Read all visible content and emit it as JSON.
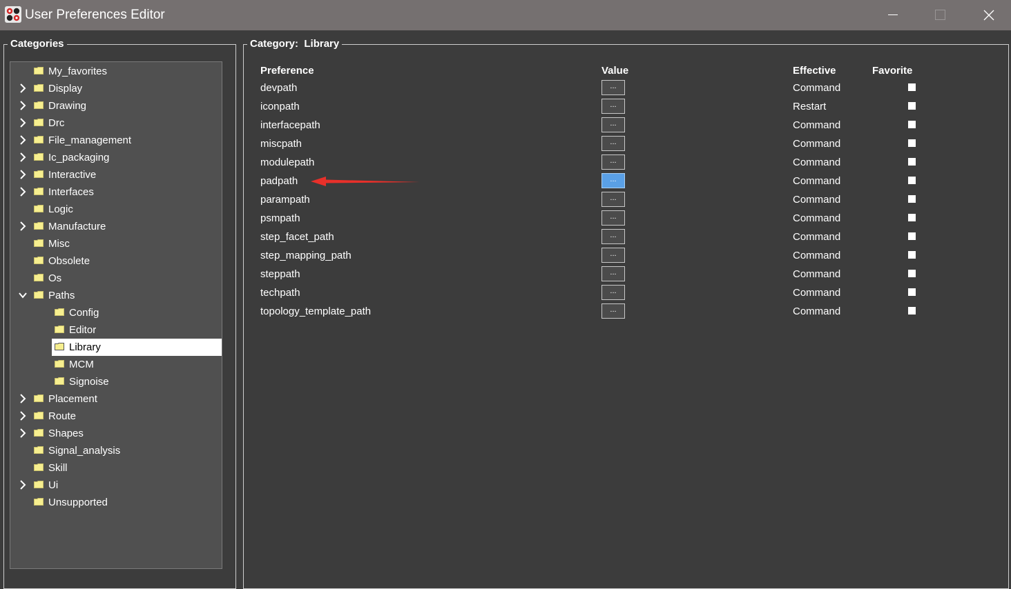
{
  "window": {
    "title": "User Preferences Editor",
    "icons": {
      "app": "app-logo-icon",
      "minimize": "minimize-icon",
      "maximize": "maximize-icon",
      "close": "close-icon"
    }
  },
  "categories": {
    "legend": "Categories",
    "items": [
      {
        "label": "My_favorites",
        "expander": "none"
      },
      {
        "label": "Display",
        "expander": "collapsed"
      },
      {
        "label": "Drawing",
        "expander": "collapsed"
      },
      {
        "label": "Drc",
        "expander": "collapsed"
      },
      {
        "label": "File_management",
        "expander": "collapsed"
      },
      {
        "label": "Ic_packaging",
        "expander": "collapsed"
      },
      {
        "label": "Interactive",
        "expander": "collapsed"
      },
      {
        "label": "Interfaces",
        "expander": "collapsed"
      },
      {
        "label": "Logic",
        "expander": "none"
      },
      {
        "label": "Manufacture",
        "expander": "collapsed"
      },
      {
        "label": "Misc",
        "expander": "none"
      },
      {
        "label": "Obsolete",
        "expander": "none"
      },
      {
        "label": "Os",
        "expander": "none"
      },
      {
        "label": "Paths",
        "expander": "expanded"
      },
      {
        "label": "Config",
        "expander": "none",
        "child": true
      },
      {
        "label": "Editor",
        "expander": "none",
        "child": true
      },
      {
        "label": "Library",
        "expander": "none",
        "child": true,
        "selected": true
      },
      {
        "label": "MCM",
        "expander": "none",
        "child": true
      },
      {
        "label": "Signoise",
        "expander": "none",
        "child": true
      },
      {
        "label": "Placement",
        "expander": "collapsed"
      },
      {
        "label": "Route",
        "expander": "collapsed"
      },
      {
        "label": "Shapes",
        "expander": "collapsed"
      },
      {
        "label": "Signal_analysis",
        "expander": "none"
      },
      {
        "label": "Skill",
        "expander": "none"
      },
      {
        "label": "Ui",
        "expander": "collapsed"
      },
      {
        "label": "Unsupported",
        "expander": "none"
      }
    ]
  },
  "preferences": {
    "category_label": "Category:",
    "category_value": "Library",
    "columns": {
      "preference": "Preference",
      "value": "Value",
      "effective": "Effective",
      "favorite": "Favorite"
    },
    "button_label": "...",
    "rows": [
      {
        "name": "devpath",
        "effective": "Command"
      },
      {
        "name": "iconpath",
        "effective": "Restart"
      },
      {
        "name": "interfacepath",
        "effective": "Command"
      },
      {
        "name": "miscpath",
        "effective": "Command"
      },
      {
        "name": "modulepath",
        "effective": "Command"
      },
      {
        "name": "padpath",
        "effective": "Command",
        "active": true
      },
      {
        "name": "parampath",
        "effective": "Command"
      },
      {
        "name": "psmpath",
        "effective": "Command"
      },
      {
        "name": "step_facet_path",
        "effective": "Command"
      },
      {
        "name": "step_mapping_path",
        "effective": "Command"
      },
      {
        "name": "steppath",
        "effective": "Command"
      },
      {
        "name": "techpath",
        "effective": "Command"
      },
      {
        "name": "topology_template_path",
        "effective": "Command"
      }
    ]
  },
  "colors": {
    "background": "#3c3c3c",
    "titlebar": "#757070",
    "folder": "#f7ef8f",
    "active_button": "#5aa0e6",
    "annotation_arrow": "#e8302a"
  }
}
